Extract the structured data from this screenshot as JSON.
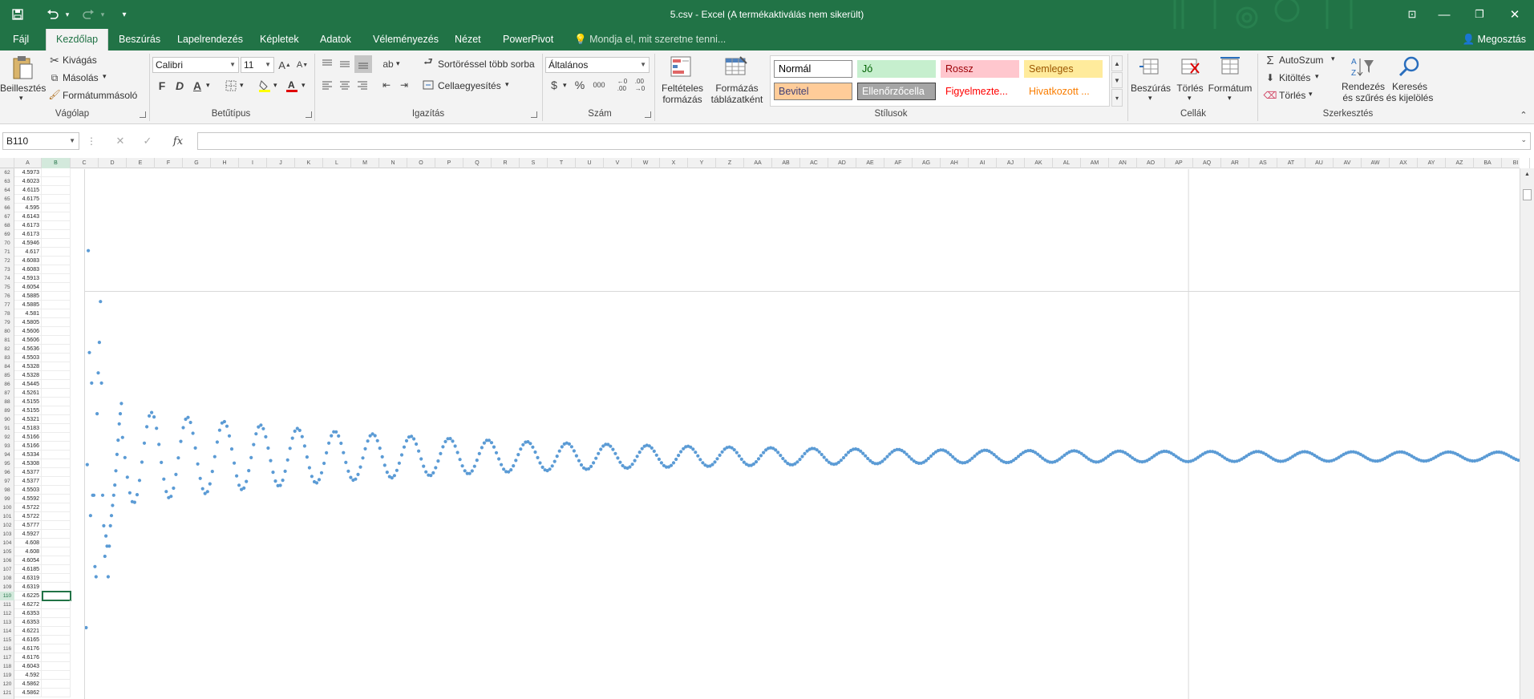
{
  "window": {
    "title": "5.csv - Excel (A termékaktiválás nem sikerült)",
    "minimize": "—",
    "restore": "❐",
    "close": "✕",
    "ribbon_display": "⊡"
  },
  "qat": {
    "save_icon": "save-icon",
    "undo_icon": "undo-icon",
    "redo_icon": "redo-icon",
    "customize": "▾"
  },
  "tabs": [
    "Fájl",
    "Kezdőlap",
    "Beszúrás",
    "Lapelrendezés",
    "Képletek",
    "Adatok",
    "Véleményezés",
    "Nézet",
    "PowerPivot"
  ],
  "active_tab": "Kezdőlap",
  "tell_me": "Mondja el, mit szeretne tenni...",
  "share": "Megosztás",
  "clipboard": {
    "paste": "Beillesztés",
    "cut": "Kivágás",
    "copy": "Másolás",
    "format_painter": "Formátummásoló",
    "label": "Vágólap"
  },
  "font": {
    "name": "Calibri",
    "size": "11",
    "bold": "F",
    "italic": "D",
    "underline": "A",
    "label": "Betűtípus",
    "fill_color": "#ffff00",
    "font_color": "#e00000"
  },
  "alignment": {
    "wrap": "Sortöréssel több sorba",
    "merge": "Cellaegyesítés",
    "label": "Igazítás"
  },
  "number": {
    "format": "Általános",
    "currency": "$",
    "percent": "%",
    "thousands": "000",
    "label": "Szám"
  },
  "styles": {
    "conditional": "Feltételes formázás",
    "format_table": "Formázás táblázatként",
    "cells": [
      {
        "label": "Normál",
        "bg": "#ffffff",
        "fg": "#000000",
        "border": "#8a8a8a"
      },
      {
        "label": "Jó",
        "bg": "#c6efce",
        "fg": "#006100",
        "border": "#c6efce"
      },
      {
        "label": "Rossz",
        "bg": "#ffc7ce",
        "fg": "#9c0006",
        "border": "#ffc7ce"
      },
      {
        "label": "Semleges",
        "bg": "#ffeb9c",
        "fg": "#9c5700",
        "border": "#ffeb9c"
      },
      {
        "label": "Bevitel",
        "bg": "#ffcc99",
        "fg": "#3f3f76",
        "border": "#7f7f7f"
      },
      {
        "label": "Ellenőrzőcella",
        "bg": "#a5a5a5",
        "fg": "#ffffff",
        "border": "#3f3f3f"
      },
      {
        "label": "Figyelmezte...",
        "bg": "#ffffff",
        "fg": "#ff0000",
        "border": "#ffffff"
      },
      {
        "label": "Hivatkozott ...",
        "bg": "#ffffff",
        "fg": "#fa7d00",
        "border": "#ffffff"
      }
    ],
    "label": "Stílusok"
  },
  "cells_group": {
    "insert": "Beszúrás",
    "delete": "Törlés",
    "format": "Formátum",
    "label": "Cellák"
  },
  "editing": {
    "autosum": "AutoSzum",
    "fill": "Kitöltés",
    "clear": "Törlés",
    "sort": "Rendezés és szűrés",
    "find": "Keresés és kijelölés",
    "label": "Szerkesztés"
  },
  "formula_bar": {
    "name_box": "B110",
    "cancel": "✕",
    "enter": "✓",
    "fx": "fx",
    "value": ""
  },
  "columns": [
    "A",
    "B",
    "C",
    "D",
    "E",
    "F",
    "G",
    "H",
    "I",
    "J",
    "K",
    "L",
    "M",
    "N",
    "O",
    "P",
    "Q",
    "R",
    "S",
    "T",
    "U",
    "V",
    "W",
    "X",
    "Y",
    "Z",
    "AA",
    "AB",
    "AC",
    "AD",
    "AE",
    "AF",
    "AG",
    "AH",
    "AI",
    "AJ",
    "AK",
    "AL",
    "AM",
    "AN",
    "AO",
    "AP",
    "AQ",
    "AR",
    "AS",
    "AT",
    "AU",
    "AV",
    "AW",
    "AX",
    "AY",
    "AZ",
    "BA",
    "BI"
  ],
  "rows": [
    {
      "n": "62",
      "a": "4.5973"
    },
    {
      "n": "63",
      "a": "4.6023"
    },
    {
      "n": "64",
      "a": "4.6115"
    },
    {
      "n": "65",
      "a": "4.6175"
    },
    {
      "n": "66",
      "a": "4.595"
    },
    {
      "n": "67",
      "a": "4.6143"
    },
    {
      "n": "68",
      "a": "4.6173"
    },
    {
      "n": "69",
      "a": "4.6173"
    },
    {
      "n": "70",
      "a": "4.5946"
    },
    {
      "n": "71",
      "a": "4.617"
    },
    {
      "n": "72",
      "a": "4.6083"
    },
    {
      "n": "73",
      "a": "4.6083"
    },
    {
      "n": "74",
      "a": "4.5913"
    },
    {
      "n": "75",
      "a": "4.6054"
    },
    {
      "n": "76",
      "a": "4.5885"
    },
    {
      "n": "77",
      "a": "4.5885"
    },
    {
      "n": "78",
      "a": "4.581"
    },
    {
      "n": "79",
      "a": "4.5805"
    },
    {
      "n": "80",
      "a": "4.5606"
    },
    {
      "n": "81",
      "a": "4.5606"
    },
    {
      "n": "82",
      "a": "4.5636"
    },
    {
      "n": "83",
      "a": "4.5503"
    },
    {
      "n": "84",
      "a": "4.5328"
    },
    {
      "n": "85",
      "a": "4.5328"
    },
    {
      "n": "86",
      "a": "4.5445"
    },
    {
      "n": "87",
      "a": "4.5261"
    },
    {
      "n": "88",
      "a": "4.5155"
    },
    {
      "n": "89",
      "a": "4.5155"
    },
    {
      "n": "90",
      "a": "4.5321"
    },
    {
      "n": "91",
      "a": "4.5183"
    },
    {
      "n": "92",
      "a": "4.5166"
    },
    {
      "n": "93",
      "a": "4.5166"
    },
    {
      "n": "94",
      "a": "4.5334"
    },
    {
      "n": "95",
      "a": "4.5308"
    },
    {
      "n": "96",
      "a": "4.5377"
    },
    {
      "n": "97",
      "a": "4.5377"
    },
    {
      "n": "98",
      "a": "4.5503"
    },
    {
      "n": "99",
      "a": "4.5592"
    },
    {
      "n": "100",
      "a": "4.5722"
    },
    {
      "n": "101",
      "a": "4.5722"
    },
    {
      "n": "102",
      "a": "4.5777"
    },
    {
      "n": "103",
      "a": "4.5927"
    },
    {
      "n": "104",
      "a": "4.608"
    },
    {
      "n": "105",
      "a": "4.608"
    },
    {
      "n": "106",
      "a": "4.6054"
    },
    {
      "n": "107",
      "a": "4.6185"
    },
    {
      "n": "108",
      "a": "4.6319"
    },
    {
      "n": "109",
      "a": "4.6319"
    },
    {
      "n": "110",
      "a": "4.6225"
    },
    {
      "n": "111",
      "a": "4.6272"
    },
    {
      "n": "112",
      "a": "4.6353"
    },
    {
      "n": "113",
      "a": "4.6353"
    },
    {
      "n": "114",
      "a": "4.6221"
    },
    {
      "n": "115",
      "a": "4.6165"
    },
    {
      "n": "116",
      "a": "4.6176"
    },
    {
      "n": "117",
      "a": "4.6176"
    },
    {
      "n": "118",
      "a": "4.6043"
    },
    {
      "n": "119",
      "a": "4.592"
    },
    {
      "n": "120",
      "a": "4.5862"
    },
    {
      "n": "121",
      "a": "4.5862"
    }
  ],
  "selected_cell": "B110",
  "chart_data": {
    "type": "scatter",
    "title": "",
    "xlabel": "",
    "ylabel": "",
    "grid": true,
    "visible_tick_label": "5",
    "marker_color": "#5b9bd5",
    "series": [
      {
        "name": "",
        "description_of_shape": "damped oscillation decaying to a plateau",
        "points": [
          [
            1,
            3.35
          ],
          [
            2,
            4.15
          ],
          [
            3,
            5.2
          ],
          [
            4,
            4.7
          ],
          [
            5,
            3.9
          ],
          [
            6,
            4.55
          ],
          [
            7,
            4.0
          ],
          [
            8,
            4.0
          ],
          [
            9,
            3.65
          ],
          [
            10,
            3.6
          ],
          [
            11,
            4.4
          ],
          [
            12,
            4.6
          ],
          [
            13,
            4.75
          ],
          [
            14,
            4.95
          ],
          [
            15,
            4.55
          ],
          [
            16,
            4.0
          ],
          [
            17,
            3.85
          ],
          [
            18,
            3.7
          ],
          [
            19,
            3.8
          ],
          [
            20,
            3.75
          ],
          [
            21,
            3.6
          ],
          [
            22,
            3.75
          ],
          [
            23,
            3.85
          ],
          [
            24,
            3.9
          ],
          [
            25,
            3.95
          ],
          [
            26,
            4.0
          ],
          [
            27,
            4.05
          ],
          [
            28,
            4.12
          ],
          [
            29,
            4.2
          ],
          [
            30,
            4.27
          ],
          [
            31,
            4.35
          ],
          [
            32,
            4.4
          ],
          [
            33,
            4.45
          ]
        ]
      }
    ],
    "plateau_value": 4.19,
    "oscillation_periods_visible": 30
  }
}
